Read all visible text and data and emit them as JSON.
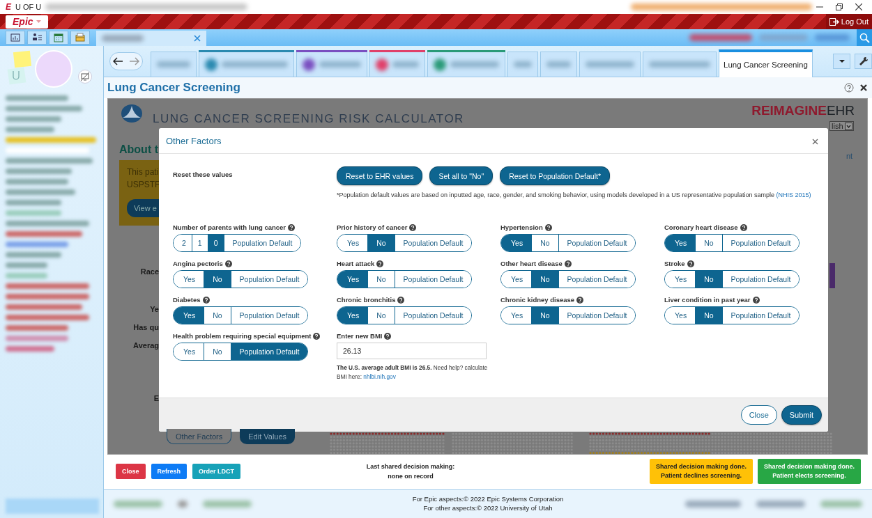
{
  "title_bar": {
    "app_initial": "E",
    "org": "U OF U"
  },
  "top_bar": {
    "menu_button": "Epic",
    "logout": "Log Out"
  },
  "activity_tabs": [
    {
      "kind": "redacted",
      "selected": false
    },
    {
      "kind": "redacted",
      "selected": false,
      "color": "#2b8ab0"
    },
    {
      "kind": "redacted",
      "selected": false,
      "color": "#7a4fc0"
    },
    {
      "kind": "redacted",
      "selected": false,
      "color": "#e0406a"
    },
    {
      "kind": "redacted",
      "selected": false,
      "color": "#2a9a78"
    },
    {
      "kind": "redacted",
      "selected": false
    },
    {
      "kind": "redacted",
      "selected": false
    },
    {
      "kind": "redacted",
      "selected": false
    },
    {
      "kind": "redacted",
      "selected": false
    },
    {
      "kind": "labeled",
      "label": "Lung Cancer Screening",
      "selected": true
    }
  ],
  "page": {
    "title": "Lung Cancer Screening"
  },
  "calculator": {
    "title": "LUNG CANCER SCREENING RISK CALCULATOR",
    "brand_bold": "REIMAGINE",
    "brand_light": "EHR",
    "language": "lish",
    "side_text": "nt",
    "about_heading": "About t",
    "eligibility_lines": [
      "This pati",
      "USPSTF"
    ],
    "view_button": "View e",
    "field_labels": [
      "Race",
      "Ye",
      "Has qu",
      "Averag",
      "E"
    ],
    "buttons": [
      {
        "label": "Other Factors",
        "kind": "outline"
      },
      {
        "label": "Edit Values",
        "kind": "filled"
      }
    ]
  },
  "modal": {
    "title": "Other Factors",
    "reset_label": "Reset these values",
    "reset_buttons": [
      "Reset to EHR values",
      "Set all to \"No\"",
      "Reset to Population Default*"
    ],
    "note": "*Population default values are based on inputted age, race, gender, and smoking behavior, using models developed in a US representative population sample ",
    "note_link": "(NHIS 2015)",
    "factors": [
      {
        "label": "Number of parents with lung cancer",
        "options": [
          {
            "label": "2",
            "selected": false
          },
          {
            "label": "1",
            "selected": false
          },
          {
            "label": "0",
            "selected": true
          },
          {
            "label": "Population Default",
            "selected": false
          }
        ]
      },
      {
        "label": "Prior history of cancer",
        "options": [
          {
            "label": "Yes",
            "selected": false
          },
          {
            "label": "No",
            "selected": true
          },
          {
            "label": "Population Default",
            "selected": false
          }
        ]
      },
      {
        "label": "Hypertension",
        "options": [
          {
            "label": "Yes",
            "selected": true
          },
          {
            "label": "No",
            "selected": false
          },
          {
            "label": "Population Default",
            "selected": false
          }
        ]
      },
      {
        "label": "Coronary heart disease",
        "options": [
          {
            "label": "Yes",
            "selected": true
          },
          {
            "label": "No",
            "selected": false
          },
          {
            "label": "Population Default",
            "selected": false
          }
        ]
      },
      {
        "label": "Angina pectoris",
        "options": [
          {
            "label": "Yes",
            "selected": false
          },
          {
            "label": "No",
            "selected": true
          },
          {
            "label": "Population Default",
            "selected": false
          }
        ]
      },
      {
        "label": "Heart attack",
        "options": [
          {
            "label": "Yes",
            "selected": true
          },
          {
            "label": "No",
            "selected": false
          },
          {
            "label": "Population Default",
            "selected": false
          }
        ]
      },
      {
        "label": "Other heart disease",
        "options": [
          {
            "label": "Yes",
            "selected": false
          },
          {
            "label": "No",
            "selected": true
          },
          {
            "label": "Population Default",
            "selected": false
          }
        ]
      },
      {
        "label": "Stroke",
        "options": [
          {
            "label": "Yes",
            "selected": false
          },
          {
            "label": "No",
            "selected": true
          },
          {
            "label": "Population Default",
            "selected": false
          }
        ]
      },
      {
        "label": "Diabetes",
        "options": [
          {
            "label": "Yes",
            "selected": true
          },
          {
            "label": "No",
            "selected": false
          },
          {
            "label": "Population Default",
            "selected": false
          }
        ]
      },
      {
        "label": "Chronic bronchitis",
        "options": [
          {
            "label": "Yes",
            "selected": true
          },
          {
            "label": "No",
            "selected": false
          },
          {
            "label": "Population Default",
            "selected": false
          }
        ]
      },
      {
        "label": "Chronic kidney disease",
        "options": [
          {
            "label": "Yes",
            "selected": false
          },
          {
            "label": "No",
            "selected": true
          },
          {
            "label": "Population Default",
            "selected": false
          }
        ]
      },
      {
        "label": "Liver condition in past year",
        "options": [
          {
            "label": "Yes",
            "selected": false
          },
          {
            "label": "No",
            "selected": true
          },
          {
            "label": "Population Default",
            "selected": false
          }
        ]
      },
      {
        "label": "Health problem requiring special equipment",
        "options": [
          {
            "label": "Yes",
            "selected": false
          },
          {
            "label": "No",
            "selected": false
          },
          {
            "label": "Population Default",
            "selected": true
          }
        ]
      }
    ],
    "bmi": {
      "label": "Enter new BMI",
      "value": "26.13",
      "hint": "**The U.S. average adult BMI is 26.5.** Need help? calculate BMI here: ",
      "hint_link": "nhlbi.nih.gov"
    },
    "buttons": [
      {
        "label": "Close",
        "kind": "secondary"
      },
      {
        "label": "Submit",
        "kind": "primary"
      }
    ]
  },
  "action_bar": {
    "buttons": [
      {
        "label": "Close",
        "color": "#dc3545"
      },
      {
        "label": "Refresh",
        "color": "#0d7bf5"
      },
      {
        "label": "Order LDCT",
        "color": "#17a2b8"
      }
    ],
    "last_sdm": [
      "Last shared decision making:",
      "none on record"
    ],
    "outcomes": [
      {
        "lines": [
          "Shared decision making done.",
          "Patient declines screening."
        ],
        "color": "#ffc107"
      },
      {
        "lines": [
          "Shared decision making done.",
          "Patient elects screening."
        ],
        "color": "#28a745"
      }
    ]
  },
  "footer": {
    "lines": [
      "For Epic aspects:© 2022 Epic Systems Corporation",
      "For other aspects:© 2022 University of Utah"
    ]
  }
}
